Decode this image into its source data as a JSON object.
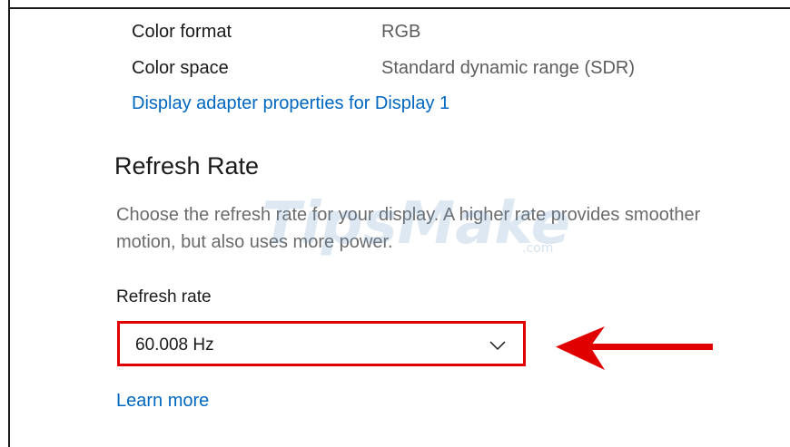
{
  "properties": [
    {
      "label": "Color format",
      "value": "RGB"
    },
    {
      "label": "Color space",
      "value": "Standard dynamic range (SDR)"
    }
  ],
  "adapter_link": "Display adapter properties for Display 1",
  "refresh_section": {
    "title": "Refresh Rate",
    "description": "Choose the refresh rate for your display. A higher rate provides smoother motion, but also uses more power.",
    "field_label": "Refresh rate",
    "selected_value": "60.008 Hz",
    "learn_more": "Learn more"
  },
  "watermark": {
    "text": "TipsMake",
    "suffix": ".com"
  },
  "colors": {
    "link": "#0067c0",
    "highlight": "#e00000",
    "arrow": "#e00000"
  },
  "icons": [
    "chevron-down-icon",
    "red-arrow-annotation"
  ]
}
